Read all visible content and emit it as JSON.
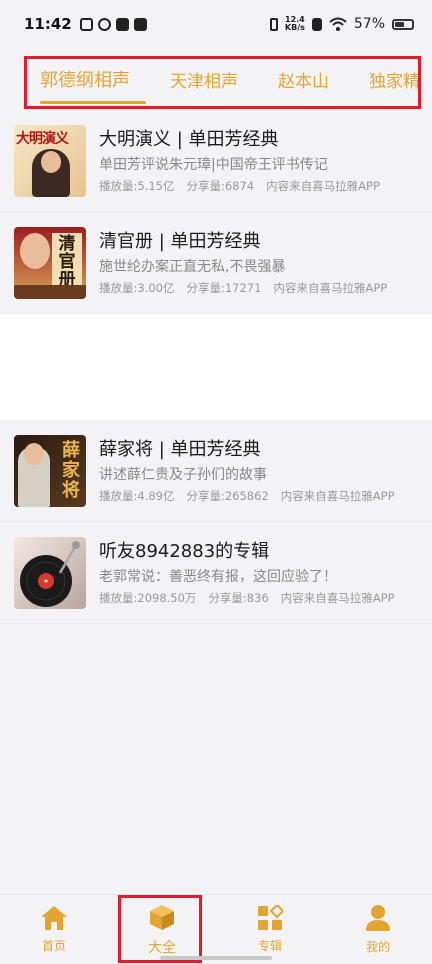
{
  "status_bar": {
    "time": "11:42",
    "net_speed_value": "12.4",
    "net_speed_unit": "KB/s",
    "battery": "57%"
  },
  "tabs": [
    {
      "label": "郭德纲相声",
      "active": true
    },
    {
      "label": "天津相声",
      "active": false
    },
    {
      "label": "赵本山",
      "active": false
    },
    {
      "label": "独家精",
      "active": false
    }
  ],
  "albums_top": [
    {
      "title": "大明演义 | 单田芳经典",
      "desc": "单田芳评说朱元璋|中国帝王评书传记",
      "plays": "播放量:5.15亿",
      "shares": "分享量:6874",
      "source": "内容来自喜马拉雅APP",
      "thumb_text": "大明演义"
    },
    {
      "title": "清官册 | 单田芳经典",
      "desc": "施世纶办案正直无私,不畏强暴",
      "plays": "播放量:3.00亿",
      "shares": "分享量:17271",
      "source": "内容来自喜马拉雅APP",
      "thumb_text": "清官册"
    }
  ],
  "albums_bottom": [
    {
      "title": "薛家将 | 单田芳经典",
      "desc": "讲述薛仁贵及子孙们的故事",
      "plays": "播放量:4.89亿",
      "shares": "分享量:265862",
      "source": "内容来自喜马拉雅APP",
      "thumb_text": "薛家将"
    },
    {
      "title": "听友8942883的专辑",
      "desc": "老郭常说：善恶终有报，这回应验了！",
      "plays": "播放量:2098.50万",
      "shares": "分享量:836",
      "source": "内容来自喜马拉雅APP",
      "thumb_text": ""
    }
  ],
  "bottom_nav": [
    {
      "label": "首页",
      "icon": "home-icon"
    },
    {
      "label": "大全",
      "icon": "box-icon",
      "active": true
    },
    {
      "label": "专辑",
      "icon": "album-grid-icon"
    },
    {
      "label": "我的",
      "icon": "user-icon"
    }
  ],
  "colors": {
    "accent": "#e3a531",
    "highlight_box": "#e11b2b",
    "background": "#f3f3f5"
  }
}
